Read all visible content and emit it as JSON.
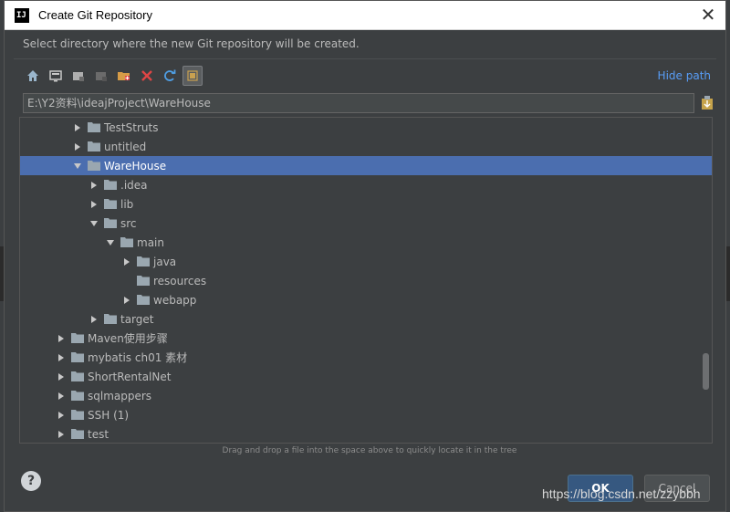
{
  "window": {
    "title": "Create Git Repository",
    "app_icon": "IJ"
  },
  "instruction": "Select directory where the new Git repository will be created.",
  "toolbar": {
    "buttons": [
      "home-icon",
      "desktop-icon",
      "project-icon",
      "module-icon",
      "new-folder-icon",
      "delete-icon",
      "refresh-icon",
      "show-hidden-icon"
    ],
    "hide_path_label": "Hide path"
  },
  "path": {
    "value": "E:\\Y2资料\\ideajProject\\WareHouse"
  },
  "tree": {
    "rows": [
      {
        "label": "TestStruts",
        "expanded": false,
        "level": 2
      },
      {
        "label": "untitled",
        "expanded": false,
        "level": 2
      },
      {
        "label": "WareHouse",
        "expanded": true,
        "level": 2,
        "selected": true
      },
      {
        "label": ".idea",
        "expanded": false,
        "level": 3
      },
      {
        "label": "lib",
        "expanded": false,
        "level": 3
      },
      {
        "label": "src",
        "expanded": true,
        "level": 3
      },
      {
        "label": "main",
        "expanded": true,
        "level": 4
      },
      {
        "label": "java",
        "expanded": false,
        "level": 5
      },
      {
        "label": "resources",
        "expanded": null,
        "level": 5
      },
      {
        "label": "webapp",
        "expanded": false,
        "level": 5
      },
      {
        "label": "target",
        "expanded": false,
        "level": 3
      },
      {
        "label": "Maven使用步骤",
        "expanded": false,
        "level": 1
      },
      {
        "label": "mybatis ch01 素材",
        "expanded": false,
        "level": 1
      },
      {
        "label": "ShortRentalNet",
        "expanded": false,
        "level": 1
      },
      {
        "label": "sqlmappers",
        "expanded": false,
        "level": 1
      },
      {
        "label": "SSH (1)",
        "expanded": false,
        "level": 1
      },
      {
        "label": "test",
        "expanded": false,
        "level": 1
      }
    ]
  },
  "hint": "Drag and drop a file into the space above to quickly locate it in the tree",
  "buttons": {
    "help": "?",
    "ok": "OK",
    "cancel": "Cancel"
  },
  "watermark": "https://blog.csdn.net/zzybbh",
  "colors": {
    "accent": "#4b6eaf",
    "link": "#589df6",
    "ok": "#365880"
  }
}
